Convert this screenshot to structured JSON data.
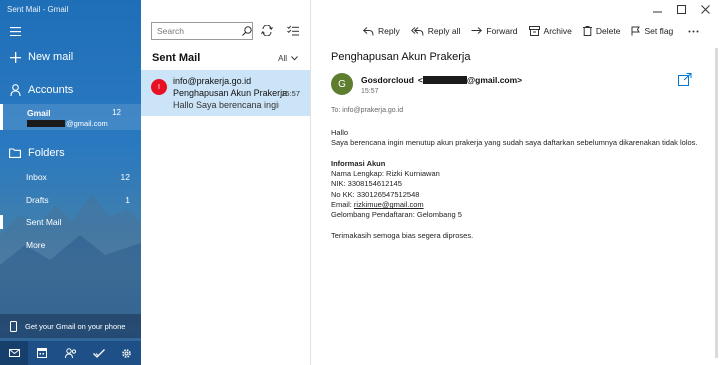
{
  "app": {
    "title": "Sent Mail - Gmail"
  },
  "sidebar": {
    "new_mail": "New mail",
    "accounts": "Accounts",
    "account": {
      "name": "Gmail",
      "count": "12",
      "email_suffix": "@gmail.com"
    },
    "folders_label": "Folders",
    "folders": [
      {
        "name": "Inbox",
        "count": "12"
      },
      {
        "name": "Drafts",
        "count": "1"
      },
      {
        "name": "Sent Mail",
        "count": ""
      },
      {
        "name": "More",
        "count": ""
      }
    ],
    "get_gmail": "Get your Gmail on your phone",
    "bottom_icons": [
      "mail-icon",
      "calendar-icon",
      "people-icon",
      "todo-icon",
      "settings-icon"
    ]
  },
  "list": {
    "search_placeholder": "Search",
    "title": "Sent Mail",
    "filter": "All",
    "message": {
      "avatar_letter": "I",
      "from": "info@prakerja.go.id",
      "subject": "Penghapusan Akun Prakerja",
      "time": "15:57",
      "preview": "Hallo Saya berencana ingin m"
    }
  },
  "toolbar": {
    "reply": "Reply",
    "reply_all": "Reply all",
    "forward": "Forward",
    "archive": "Archive",
    "delete": "Delete",
    "set_flag": "Set flag"
  },
  "email": {
    "subject": "Penghapusan Akun Prakerja",
    "sender_initial": "G",
    "sender_name": "Gosdorcloud",
    "sender_open": "<",
    "sender_suffix": "@gmail.com>",
    "time": "15:57",
    "to": "To: info@prakerja.go.id",
    "greeting": "Hallo",
    "line1": "Saya berencana ingin menutup akun prakerja yang sudah saya daftarkan sebelumnya dikarenakan tidak lolos.",
    "info_heading": "Informasi Akun",
    "nama": "Nama Lengkap: Rizki Kurniawan",
    "nik": "NIK: 3308154612145",
    "nokk": "No KK: 3301265475125​48",
    "email_label": "Email: ",
    "email_value": "rizkimue@gmail.com",
    "gelombang": "Gelombang Pendaftaran: Gelombang 5",
    "closing": "Terimakasih semoga bias segera diproses."
  },
  "colors": {
    "accent": "#0078d7",
    "sidebar": "#2a79c0",
    "selected_row": "#cce4f7",
    "avatar_red": "#e81123",
    "avatar_green": "#5e7d2e"
  }
}
